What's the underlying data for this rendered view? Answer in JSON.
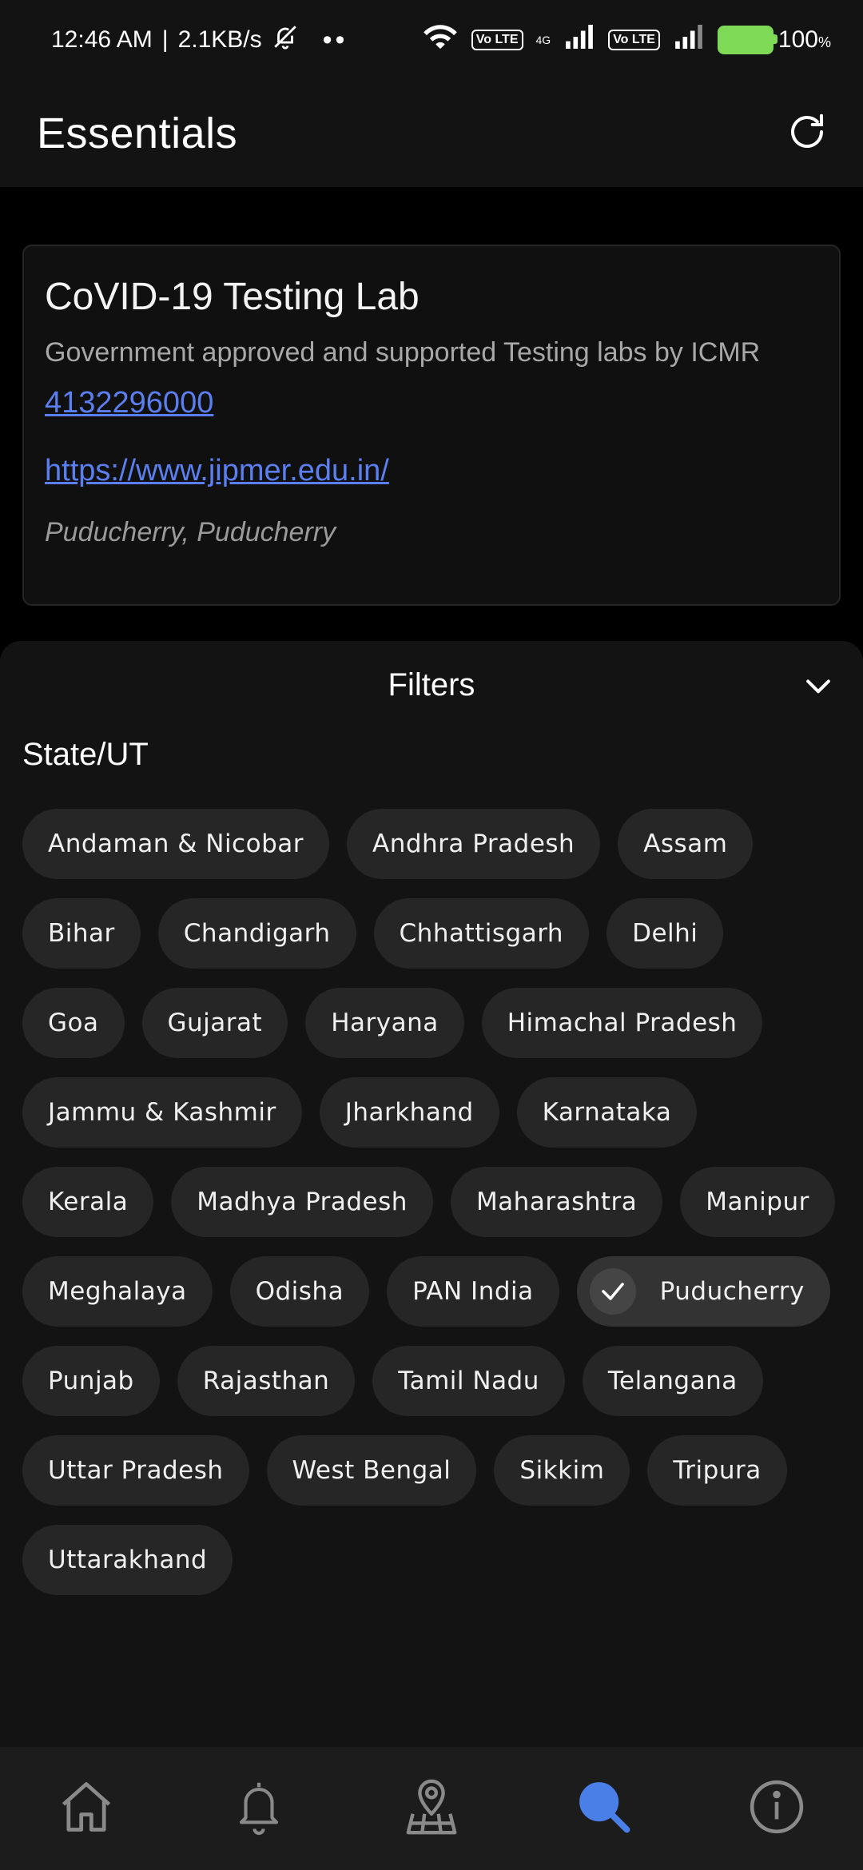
{
  "status_bar": {
    "time": "12:46 AM",
    "separator": "|",
    "speed": "2.1KB/s",
    "dots": "••",
    "lte1": "Vo LTE",
    "lte2": "Vo LTE",
    "net": "4G",
    "battery": "100",
    "battery_unit": "%"
  },
  "app_bar": {
    "title": "Essentials",
    "refresh_icon": "refresh-icon"
  },
  "card": {
    "title": "CoVID-19 Testing Lab",
    "description": "Government approved and supported Testing labs by ICMR",
    "phone": "4132296000",
    "website": "https://www.jipmer.edu.in/",
    "location": "Puducherry, Puducherry"
  },
  "filters": {
    "title": "Filters",
    "section_label": "State/UT",
    "chips": [
      {
        "label": "Andaman & Nicobar",
        "selected": false
      },
      {
        "label": "Andhra Pradesh",
        "selected": false
      },
      {
        "label": "Assam",
        "selected": false
      },
      {
        "label": "Bihar",
        "selected": false
      },
      {
        "label": "Chandigarh",
        "selected": false
      },
      {
        "label": "Chhattisgarh",
        "selected": false
      },
      {
        "label": "Delhi",
        "selected": false
      },
      {
        "label": "Goa",
        "selected": false
      },
      {
        "label": "Gujarat",
        "selected": false
      },
      {
        "label": "Haryana",
        "selected": false
      },
      {
        "label": "Himachal Pradesh",
        "selected": false
      },
      {
        "label": "Jammu & Kashmir",
        "selected": false
      },
      {
        "label": "Jharkhand",
        "selected": false
      },
      {
        "label": "Karnataka",
        "selected": false
      },
      {
        "label": "Kerala",
        "selected": false
      },
      {
        "label": "Madhya Pradesh",
        "selected": false
      },
      {
        "label": "Maharashtra",
        "selected": false
      },
      {
        "label": "Manipur",
        "selected": false
      },
      {
        "label": "Meghalaya",
        "selected": false
      },
      {
        "label": "Odisha",
        "selected": false
      },
      {
        "label": "PAN India",
        "selected": false
      },
      {
        "label": "Puducherry",
        "selected": true
      },
      {
        "label": "Punjab",
        "selected": false
      },
      {
        "label": "Rajasthan",
        "selected": false
      },
      {
        "label": "Tamil Nadu",
        "selected": false
      },
      {
        "label": "Telangana",
        "selected": false
      },
      {
        "label": "Uttar Pradesh",
        "selected": false
      },
      {
        "label": "West Bengal",
        "selected": false
      },
      {
        "label": "Sikkim",
        "selected": false
      },
      {
        "label": "Tripura",
        "selected": false
      },
      {
        "label": "Uttarakhand",
        "selected": false
      }
    ]
  },
  "bottom_nav": {
    "items": [
      {
        "icon": "home-icon",
        "active": false
      },
      {
        "icon": "bell-icon",
        "active": false
      },
      {
        "icon": "map-pin-icon",
        "active": false
      },
      {
        "icon": "search-icon",
        "active": true
      },
      {
        "icon": "info-icon",
        "active": false
      }
    ]
  },
  "colors": {
    "background": "#000000",
    "surface": "#131313",
    "chip": "#262626",
    "link": "#5b7ff0",
    "active_nav": "#4a7fe8",
    "inactive_nav": "#8a8a8a"
  }
}
